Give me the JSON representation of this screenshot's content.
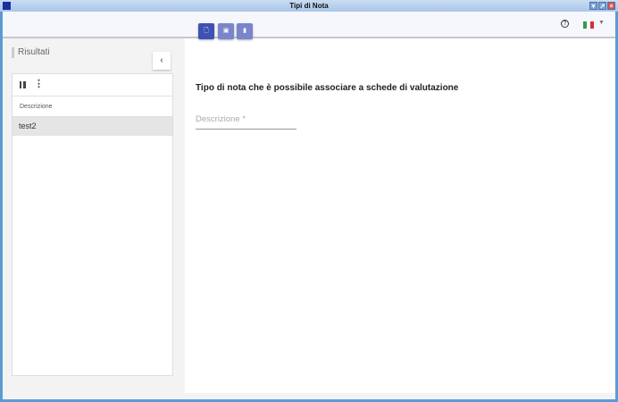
{
  "window": {
    "title": "Tipi di Nota"
  },
  "header": {
    "help_icon": "?",
    "language": "it"
  },
  "left": {
    "title": "Risultati",
    "collapse": "‹",
    "table": {
      "columns": [
        "Descrizione"
      ],
      "rows": [
        [
          "test2"
        ]
      ]
    }
  },
  "main": {
    "buttons": [
      {
        "name": "new",
        "icon": "🗋"
      },
      {
        "name": "save",
        "icon": "💾"
      },
      {
        "name": "delete",
        "icon": "🗑"
      }
    ],
    "heading": "Tipo di nota che è possibile associare a schede di valutazione",
    "field": {
      "placeholder": "Descrizione *",
      "value": ""
    }
  },
  "colors": {
    "primary": "#3f51b5",
    "disabled": "#7986cb"
  }
}
